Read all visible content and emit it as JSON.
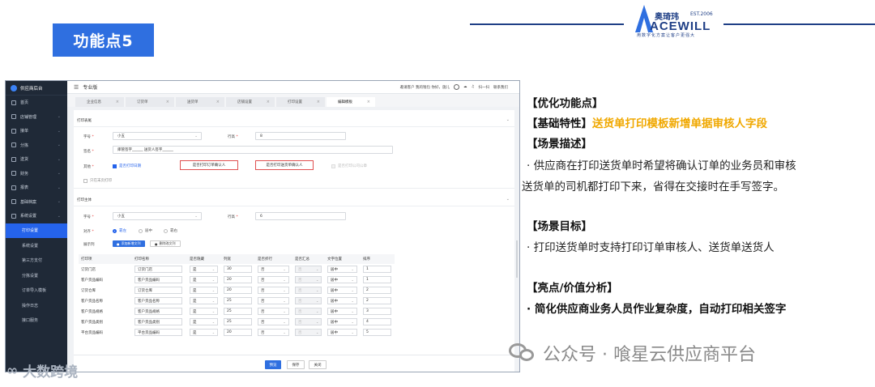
{
  "slide": {
    "feature_tag": "功能点5",
    "logo": {
      "cn": "奥琦玮",
      "est": "EST.2006",
      "en": "ACEWILL",
      "tagline": "用数字化方案让客户更强大"
    }
  },
  "app": {
    "brand": "供应商后台",
    "topbar": {
      "title": "专业版",
      "right_text": "邀请客户 我的钱包  你好，施儿",
      "scan": "扫一扫",
      "contact": "联系我们"
    },
    "sidebar": [
      {
        "label": "首页",
        "icon": "home-icon"
      },
      {
        "label": "店铺管理",
        "icon": "store-icon"
      },
      {
        "label": "接单",
        "icon": "order-icon"
      },
      {
        "label": "分拣",
        "icon": "sort-icon"
      },
      {
        "label": "送货",
        "icon": "truck-icon"
      },
      {
        "label": "财务",
        "icon": "finance-icon"
      },
      {
        "label": "报表",
        "icon": "report-icon"
      },
      {
        "label": "基础档案",
        "icon": "archive-icon"
      },
      {
        "label": "系统设置",
        "icon": "gear-icon"
      }
    ],
    "sidebar_sub": [
      {
        "label": "打印设置",
        "active": true
      },
      {
        "label": "系统设置",
        "active": false
      },
      {
        "label": "第三方支付",
        "active": false
      },
      {
        "label": "分拣设置",
        "active": false
      },
      {
        "label": "订单导入模板",
        "active": false
      },
      {
        "label": "操作日志",
        "active": false
      },
      {
        "label": "接口服务",
        "active": false
      }
    ],
    "tabs": [
      {
        "label": "企业信息",
        "active": false
      },
      {
        "label": "订货单",
        "active": false
      },
      {
        "label": "送货单",
        "active": false
      },
      {
        "label": "店铺设置",
        "active": false
      },
      {
        "label": "打印设置",
        "active": false
      },
      {
        "label": "编辑模板",
        "active": true
      }
    ],
    "print_header": {
      "section": "打印表尾",
      "font_label": "字号",
      "font_value": "小五",
      "row_height_label": "行高",
      "row_height_value": "8",
      "sign_label": "签名",
      "sign_value": "库管签字______ 送货人签字______",
      "other_label": "其他",
      "chk_print_time": "是否打印日期",
      "redbox_order": "是否打印订单确认人",
      "redbox_delivery": "是否打印送货单确认人",
      "chk_company_seal": "是否打印公司公章",
      "chk_first_page": "只在末页打印"
    },
    "print_body": {
      "section": "打印主体",
      "font_label": "字号",
      "font_value": "小五",
      "row_height_label": "行高",
      "row_height_value": "6",
      "align_label": "对齐",
      "align_options": [
        "靠左",
        "居中",
        "靠右"
      ],
      "display_cols_label": "展示列",
      "btn_add_col": "添加新增文列",
      "btn_del_col": "删除改文列"
    },
    "grid": {
      "headers": [
        "打印项",
        "打印名称",
        "是否隐藏",
        "列宽",
        "是否折行",
        "是否汇总",
        "文字位置",
        "排序"
      ],
      "rows": [
        [
          "订货门店",
          "订货门店",
          "是",
          "30",
          "否",
          "否",
          "居中",
          "1"
        ],
        [
          "客户货品编码",
          "客户货品编码",
          "是",
          "20",
          "否",
          "否",
          "居中",
          "1"
        ],
        [
          "订货仓库",
          "订货仓库",
          "是",
          "20",
          "否",
          "否",
          "居中",
          "2"
        ],
        [
          "客户货品名称",
          "客户货品名称",
          "是",
          "25",
          "否",
          "否",
          "居中",
          "2"
        ],
        [
          "客户货品规格",
          "客户货品规格",
          "是",
          "25",
          "否",
          "否",
          "居中",
          "3"
        ],
        [
          "客户货品类别",
          "客户货品类别",
          "是",
          "25",
          "否",
          "否",
          "居中",
          "4"
        ],
        [
          "平台货品编码",
          "平台货品编码",
          "是",
          "20",
          "否",
          "否",
          "居中",
          "5"
        ]
      ]
    },
    "footer": {
      "preview": "预览",
      "save": "保存",
      "close": "关闭"
    }
  },
  "panel": {
    "h_opt": "【优化功能点】",
    "h_basic": "【基础特性】",
    "basic_highlight": "送货单打印模板新增单据审核人字段",
    "h_scene": "【场景描述】",
    "scene_line1": "·  供应商在打印送货单时希望将确认订单的业务员和审核",
    "scene_line2": "送货单的司机都打印下来，省得在交接时在手写签字。",
    "h_goal": "【场景目标】",
    "goal_line": "·  打印送货单时支持打印订单审核人、送货单送货人",
    "h_value": "【亮点/价值分析】",
    "value_line": "·  简化供应商业务人员作业复杂度，自动打印相关签字"
  },
  "watermarks": {
    "right": "公众号 · 喰星云供应商平台",
    "left": "大数跨境"
  },
  "colors": {
    "brand_blue": "#2f6fe0",
    "highlight": "#f0a800",
    "logo_navy": "#1f3f86",
    "sidebar": "#1f2937"
  }
}
